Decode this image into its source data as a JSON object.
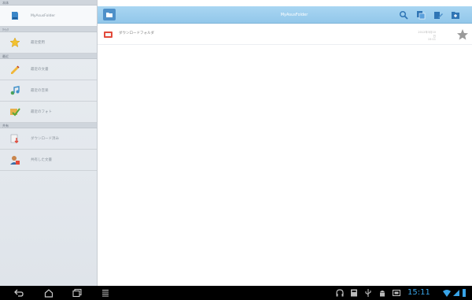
{
  "sidebar": {
    "sections": [
      {
        "header": "本体",
        "items": [
          {
            "label": "MyAsusFolder",
            "icon": "device-icon"
          }
        ]
      },
      {
        "header": "ｸｲｯｸ",
        "items": [
          {
            "label": "最近使用",
            "icon": "star-icon"
          }
        ]
      },
      {
        "header": "最近",
        "items": [
          {
            "label": "最近の文書",
            "icon": "doc-pen-icon"
          },
          {
            "label": "最近の音楽",
            "icon": "music-icon"
          },
          {
            "label": "最近のフォト",
            "icon": "photo-check-icon"
          }
        ]
      },
      {
        "header": "共有",
        "items": [
          {
            "label": "ダウンロード済み",
            "icon": "download-icon"
          },
          {
            "label": "共有した文書",
            "icon": "shared-person-icon"
          }
        ]
      }
    ]
  },
  "topbar": {
    "title": "MyAsusFolder",
    "icons": [
      "search-icon",
      "copy-icon",
      "edit-icon",
      "new-folder-icon"
    ]
  },
  "files": [
    {
      "name": "ダウンロードフォルダ",
      "meta_line1": "2012年3月10日",
      "meta_line2": "15:11",
      "icon": "folder-icon"
    }
  ],
  "statusbar": {
    "time": "15:11",
    "nav_icons": [
      "back-icon",
      "home-icon",
      "recent-apps-icon",
      "menu-icon"
    ],
    "notification_icons": [
      "headset-icon",
      "notification-icon",
      "usb-icon",
      "android-icon",
      "screenshot-icon"
    ],
    "status_icons": [
      "wifi-icon",
      "signal-icon",
      "battery-icon"
    ]
  },
  "colors": {
    "topbar": "#a9d6f2",
    "accent": "#4e90c9",
    "clock": "#39a4e8",
    "folder": "#e24a3b"
  }
}
